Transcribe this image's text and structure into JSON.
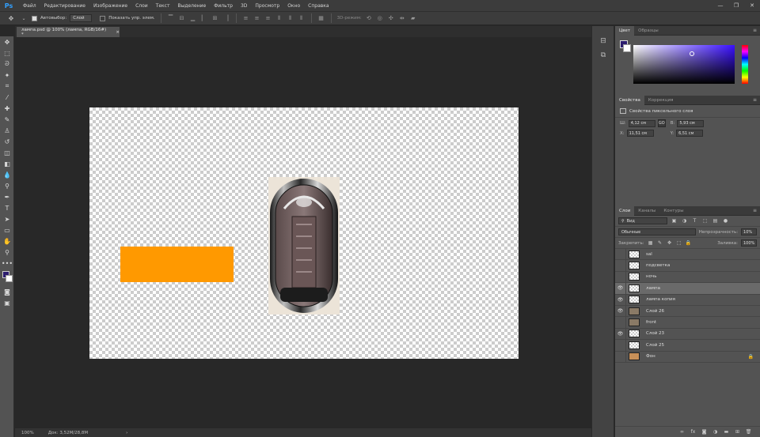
{
  "app": {
    "logo": "Ps",
    "menu": [
      "Файл",
      "Редактирование",
      "Изображение",
      "Слои",
      "Текст",
      "Выделение",
      "Фильтр",
      "3D",
      "Просмотр",
      "Окно",
      "Справка"
    ],
    "window_controls": [
      "—",
      "❐",
      "✕"
    ]
  },
  "options": {
    "auto_select_label": "Автовыбор:",
    "auto_select_value": "Слой",
    "show_transform_label": "Показать упр. элем.",
    "mode_3d_label": "3D-режим:"
  },
  "document": {
    "tab_title": "лампа.psd @ 100% (лампа, RGB/16#) *",
    "tab_close": "×",
    "zoom": "100%",
    "doc_size": "Док: 3,52M/28,8M"
  },
  "colors": {
    "foreground": "#2c1d6e",
    "background": "#ffffff",
    "orange": "#ff9900"
  },
  "color_panel": {
    "tabs": [
      "Цвет",
      "Образцы"
    ]
  },
  "properties_panel": {
    "tabs": [
      "Свойства",
      "Коррекция"
    ],
    "title": "Свойства пиксельного слоя",
    "w_label": "Ш:",
    "w_value": "4,12 см",
    "h_label": "В:",
    "h_value": "5,93 см",
    "x_label": "X:",
    "x_value": "11,51 см",
    "y_label": "Y:",
    "y_value": "6,51 см",
    "link_label": "GO"
  },
  "layers_panel": {
    "tabs": [
      "Слои",
      "Каналы",
      "Контуры"
    ],
    "kind": "Вид",
    "blend_mode": "Обычные",
    "opacity_label": "Непрозрачность:",
    "opacity_value": "10%",
    "lock_label": "Закрепить:",
    "fill_label": "Заливка:",
    "fill_value": "100%",
    "layers": [
      {
        "name": "sal",
        "visible": false,
        "thumb": "transparent",
        "selected": false,
        "locked": false
      },
      {
        "name": "подсветка",
        "visible": false,
        "thumb": "transparent",
        "selected": false,
        "locked": false
      },
      {
        "name": "ночь",
        "visible": false,
        "thumb": "transparent",
        "selected": false,
        "locked": false
      },
      {
        "name": "лампа",
        "visible": true,
        "thumb": "transparent",
        "selected": true,
        "locked": false
      },
      {
        "name": "лампа копия",
        "visible": true,
        "thumb": "transparent",
        "selected": false,
        "locked": false
      },
      {
        "name": "Слой 26",
        "visible": true,
        "thumb": "photo",
        "selected": false,
        "locked": false
      },
      {
        "name": "front",
        "visible": false,
        "thumb": "photo",
        "selected": false,
        "locked": false
      },
      {
        "name": "Слой 23",
        "visible": true,
        "thumb": "transparent",
        "selected": false,
        "locked": false
      },
      {
        "name": "Слой 25",
        "visible": false,
        "thumb": "transparent",
        "selected": false,
        "locked": false
      },
      {
        "name": "Фон",
        "visible": false,
        "thumb": "bgfill",
        "selected": false,
        "locked": true
      }
    ]
  }
}
